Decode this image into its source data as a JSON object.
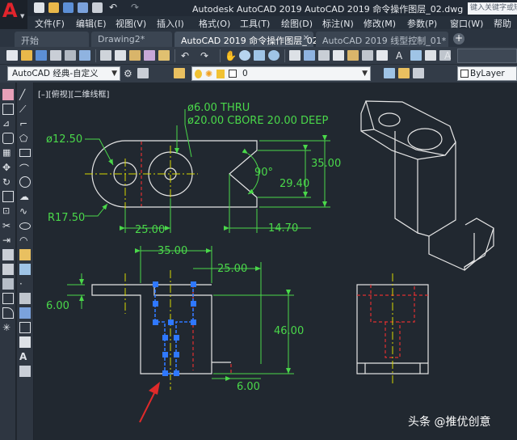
{
  "app": {
    "title": "Autodesk AutoCAD 2019     AutoCAD 2019 命令操作图层_02.dwg",
    "search_placeholder": "键入关键字或短语"
  },
  "menu": {
    "items": [
      "文件(F)",
      "编辑(E)",
      "视图(V)",
      "插入(I)",
      "格式(O)",
      "工具(T)",
      "绘图(D)",
      "标注(N)",
      "修改(M)",
      "参数(P)",
      "窗口(W)",
      "帮助"
    ]
  },
  "tabs": {
    "items": [
      "开始",
      "Drawing2*",
      "AutoCAD 2019 命令操作图层_02*",
      "AutoCAD 2019 线型控制_01*"
    ],
    "add_label": "+"
  },
  "toolbar": {
    "workspace": "AutoCAD 经典-自定义",
    "layer": "0",
    "color": "ByLayer"
  },
  "viewport": {
    "label": "[–][俯视][二维线框]"
  },
  "drawing": {
    "dims": {
      "d_hole": "ø6.00 THRU",
      "d_cbore": "ø20.00 CBORE 20.00 DEEP",
      "d_phi": "ø12.50",
      "d_r": "R17.50",
      "d_angle": "90°",
      "d_35a": "35.00",
      "d_2940": "29.40",
      "d_25a": "25.00",
      "d_1470": "14.70",
      "d_35b": "35.00",
      "d_25b": "25.00",
      "d_6a": "6.00",
      "d_46": "46.00",
      "d_6b": "6.00"
    }
  },
  "watermark": {
    "text": "头条 @推优创意"
  },
  "colors": {
    "background": "#212830",
    "object_lines": "#e6e6e6",
    "dimensions": "#4ad84a",
    "center_lines": "#d8d800",
    "hidden_lines": "#e03030",
    "grips": "#2f78ff",
    "arrow": "#e02a2a"
  }
}
